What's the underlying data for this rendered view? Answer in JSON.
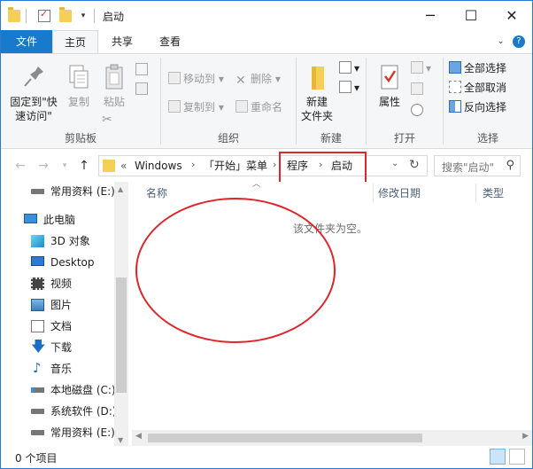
{
  "window": {
    "title": "启动"
  },
  "tabs": {
    "file": "文件",
    "home": "主页",
    "share": "共享",
    "view": "查看"
  },
  "ribbon": {
    "clipboard": {
      "label": "剪贴板",
      "pin_line1": "固定到\"快",
      "pin_line2": "速访问\"",
      "copy": "复制",
      "paste": "粘贴"
    },
    "organize": {
      "label": "组织",
      "move_to": "移动到",
      "copy_to": "复制到",
      "delete": "删除",
      "rename": "重命名"
    },
    "new": {
      "label": "新建",
      "new_folder_line1": "新建",
      "new_folder_line2": "文件夹"
    },
    "open": {
      "label": "打开",
      "properties": "属性"
    },
    "select": {
      "label": "选择",
      "select_all": "全部选择",
      "select_none": "全部取消",
      "invert": "反向选择"
    }
  },
  "address": {
    "overflow": "«",
    "crumbs": [
      "Windows",
      "「开始」菜单",
      "程序",
      "启动"
    ],
    "search_placeholder": "搜索\"启动\""
  },
  "nav_pane": {
    "items": [
      {
        "label": "常用资料 (E:)",
        "icon": "drive-icon"
      },
      {
        "label": "此电脑",
        "icon": "computer-icon"
      },
      {
        "label": "3D 对象",
        "icon": "3d-objects-icon"
      },
      {
        "label": "Desktop",
        "icon": "desktop-icon"
      },
      {
        "label": "视频",
        "icon": "video-icon"
      },
      {
        "label": "图片",
        "icon": "pictures-icon"
      },
      {
        "label": "文档",
        "icon": "documents-icon"
      },
      {
        "label": "下载",
        "icon": "download-icon"
      },
      {
        "label": "音乐",
        "icon": "music-icon"
      },
      {
        "label": "本地磁盘 (C:)",
        "icon": "drive-icon"
      },
      {
        "label": "系统软件 (D:)",
        "icon": "drive-icon"
      },
      {
        "label": "常用资料 (E:)",
        "icon": "drive-icon"
      }
    ]
  },
  "content": {
    "columns": {
      "name": "名称",
      "modified": "修改日期",
      "type": "类型"
    },
    "empty_message": "该文件夹为空。"
  },
  "status": {
    "item_count": "0 个项目"
  },
  "colors": {
    "accent": "#1979ca",
    "annotation": "#e0252a"
  }
}
